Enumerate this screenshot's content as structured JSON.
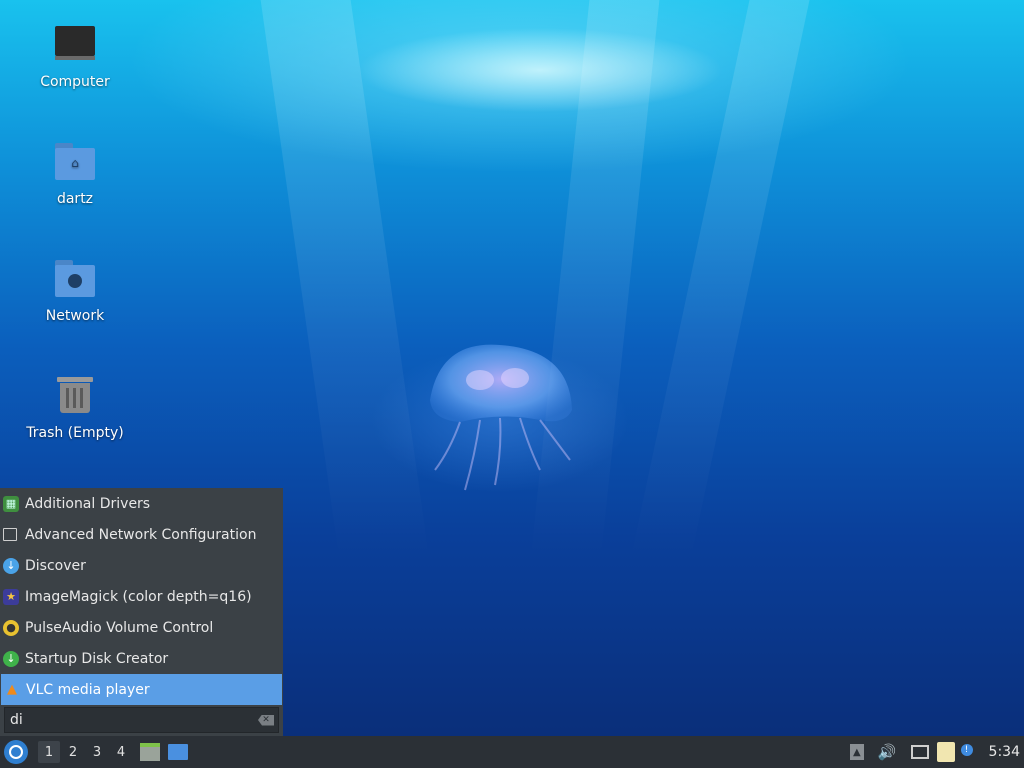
{
  "desktop": {
    "icons": [
      {
        "label": "Computer",
        "icon": "computer-icon"
      },
      {
        "label": "dartz",
        "icon": "home-folder-icon"
      },
      {
        "label": "Network",
        "icon": "network-folder-icon"
      },
      {
        "label": "Trash (Empty)",
        "icon": "trash-icon"
      }
    ]
  },
  "menu": {
    "items": [
      {
        "label": "Additional Drivers",
        "icon": "chip-icon"
      },
      {
        "label": "Advanced Network Configuration",
        "icon": "network-monitor-icon"
      },
      {
        "label": "Discover",
        "icon": "download-icon"
      },
      {
        "label": "ImageMagick (color depth=q16)",
        "icon": "imagemagick-icon"
      },
      {
        "label": "PulseAudio Volume Control",
        "icon": "speaker-icon"
      },
      {
        "label": "Startup Disk Creator",
        "icon": "usb-download-icon"
      },
      {
        "label": "VLC media player",
        "icon": "vlc-icon",
        "selected": true
      }
    ],
    "search_value": "di"
  },
  "taskbar": {
    "workspaces": [
      "1",
      "2",
      "3",
      "4"
    ],
    "active_workspace": "1",
    "clock": "5:34"
  },
  "colors": {
    "panel": "#2b3036",
    "menu_bg": "#3b4146",
    "selection": "#5a9ee6"
  }
}
